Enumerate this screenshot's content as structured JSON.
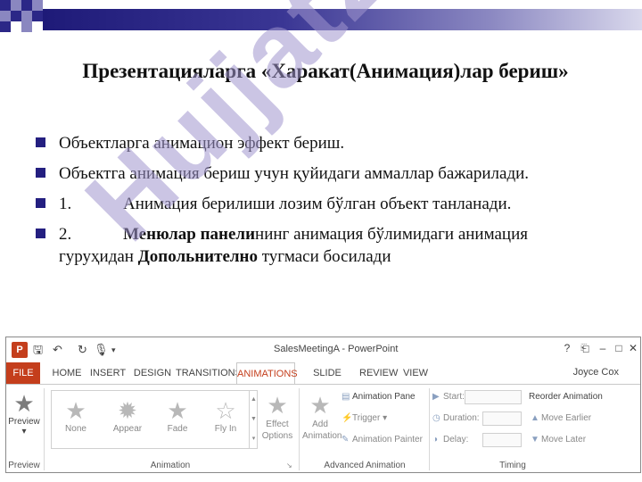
{
  "title": "Презентацияларга  «Харакат(Анимация)лар бериш»",
  "bullets": [
    {
      "text": "Объектларга анимацион эффект бериш."
    },
    {
      "text": "Объектга анимация бериш учун қуйидаги аммаллар бажарилади."
    },
    {
      "num": "1.",
      "text": "Анимация берилиши лозим бўлган объект танланади."
    },
    {
      "num": "2.",
      "bold1": "Менюлар панели",
      "text1": "нинг  анимация  бўлимидаги анимация гуруҳидан  ",
      "bold2": "Допольнително",
      "text2": "  тугмаси босилади"
    }
  ],
  "watermark": "Hujjat24",
  "ppt": {
    "window_title": "SalesMeetingA - PowerPoint",
    "app_icon": "P",
    "tabs": [
      "FILE",
      "HOME",
      "INSERT",
      "DESIGN",
      "TRANSITIONS",
      "ANIMATIONS",
      "SLIDE SHOW",
      "REVIEW",
      "VIEW"
    ],
    "active_tab": "ANIMATIONS",
    "user": "Joyce Cox",
    "preview_label": "Preview",
    "preview_group": "Preview",
    "effects": [
      "None",
      "Appear",
      "Fade",
      "Fly In"
    ],
    "effect_options": "Effect Options",
    "animation_group": "Animation",
    "add_animation": "Add Animation",
    "animation_pane": "Animation Pane",
    "trigger": "Trigger",
    "animation_painter": "Animation Painter",
    "advanced_group": "Advanced Animation",
    "start": "Start:",
    "duration": "Duration:",
    "delay": "Delay:",
    "reorder": "Reorder Animation",
    "move_earlier": "Move Earlier",
    "move_later": "Move Later",
    "timing_group": "Timing"
  }
}
